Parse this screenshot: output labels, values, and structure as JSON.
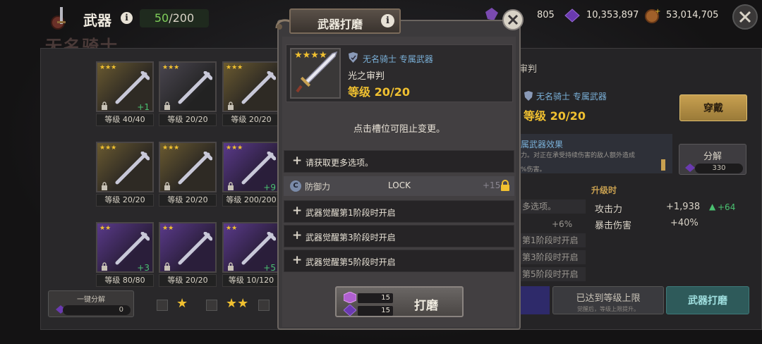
{
  "topbar": {
    "title": "武器",
    "info_glyph": "i",
    "capacity_current": "50",
    "capacity_total": "/200",
    "hero_name_bg": "无名骑士",
    "currency_1": "805",
    "currency_2": "10,353,897",
    "currency_3": "53,014,705"
  },
  "inventory": {
    "slots": [
      {
        "level": "等级 40/40",
        "plus": "+1",
        "theme": "gold",
        "stars": "★★★"
      },
      {
        "level": "等级 20/20",
        "plus": "",
        "theme": "dark",
        "stars": "★★★"
      },
      {
        "level": "等级 20/20",
        "plus": "",
        "theme": "gold",
        "stars": "★★★"
      },
      {
        "level": "等级 20/20",
        "plus": "",
        "theme": "gold",
        "stars": "★★★"
      },
      {
        "level": "等级 20/20",
        "plus": "",
        "theme": "gold",
        "stars": "★★★"
      },
      {
        "level": "等级 200/200",
        "plus": "+9",
        "theme": "purple",
        "stars": "★★★"
      },
      {
        "level": "等级 80/80",
        "plus": "+3",
        "theme": "purple",
        "stars": "★★"
      },
      {
        "level": "等级 20/20",
        "plus": "",
        "theme": "purple",
        "stars": "★★"
      },
      {
        "level": "等级 10/120",
        "plus": "+5",
        "theme": "purple",
        "stars": "★★"
      }
    ],
    "bulk_label": "一键分解",
    "bulk_value": "0"
  },
  "right_panel": {
    "title_fragment": "审判",
    "exclusive": "无名骑士 专属武器",
    "level": "等级 20/20",
    "equip_label": "穿戴",
    "effect_title": "属武器效果",
    "effect_desc": "力。对正在承受持续伤害的敌人额外造成",
    "effect_desc2": "%伤害。",
    "dismantle_label": "分解",
    "dismantle_value": "330",
    "upgrade_head": "升级时",
    "stats": [
      {
        "name": "攻击力",
        "value": "+1,938",
        "inc": "+64"
      },
      {
        "name": "暴击伤害",
        "value": "+40%",
        "inc": ""
      }
    ],
    "rows": [
      "多选项。",
      "第1阶段时开启",
      "第3阶段时开启",
      "第5阶段时开启"
    ],
    "pct": "+6%",
    "maxed_label": "已达到等级上限",
    "maxed_sub": "觉醒后，等级上限提升。",
    "sharpen_label": "武器打磨"
  },
  "modal": {
    "title": "武器打磨",
    "info_glyph": "i",
    "weapon": {
      "exclusive": "无名骑士 专属武器",
      "name": "光之审判",
      "level": "等级 20/20",
      "stars": "★★★★"
    },
    "hint": "点击槽位可阻止变更。",
    "options": [
      {
        "text": "请获取更多选项。"
      }
    ],
    "lock_row": {
      "badge": "C",
      "name": "防御力",
      "lock_text": "LOCK",
      "value": "+15"
    },
    "awaken_rows": [
      {
        "text": "武器觉醒第1阶段时开启"
      },
      {
        "text": "武器觉醒第3阶段时开启"
      },
      {
        "text": "武器觉醒第5阶段时开启"
      }
    ],
    "sharpen": {
      "label": "打磨",
      "cost_1": "15",
      "cost_2": "15"
    }
  },
  "colors": {
    "gold": "#f0c030",
    "blue_text": "#7ab0d8",
    "green": "#4ac070"
  }
}
